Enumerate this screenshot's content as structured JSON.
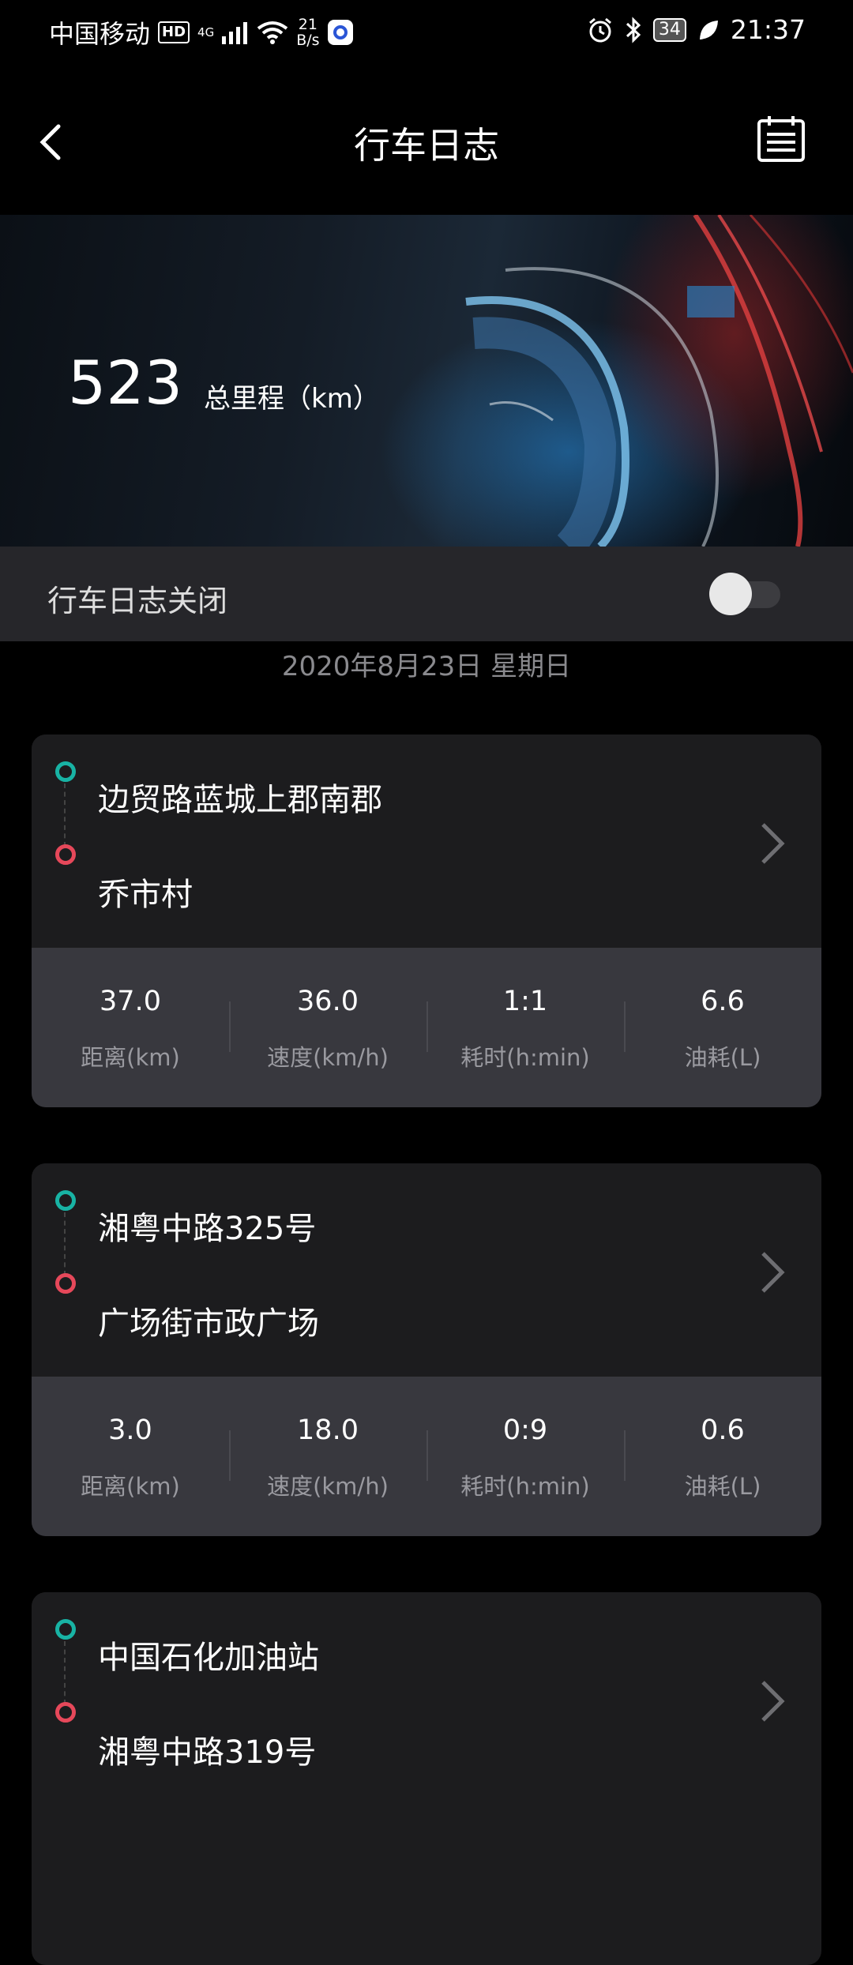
{
  "status_bar": {
    "carrier": "中国移动",
    "hd": "HD",
    "network": "4G",
    "speed_value": "21",
    "speed_unit": "B/s",
    "battery": "34",
    "time": "21:37"
  },
  "nav": {
    "title": "行车日志",
    "back_icon": "back-chevron-icon",
    "calendar_icon": "calendar-icon"
  },
  "banner": {
    "total_mileage": "523",
    "total_mileage_label": "总里程（km）"
  },
  "toggle": {
    "label": "行车日志关闭",
    "state": "off"
  },
  "date_header": "2020年8月23日 星期日",
  "trips": [
    {
      "start": "边贸路蓝城上郡南郡",
      "end": "乔市村",
      "stats": [
        {
          "value": "37.0",
          "label": "距离(km)"
        },
        {
          "value": "36.0",
          "label": "速度(km/h)"
        },
        {
          "value": "1:1",
          "label": "耗时(h:min)"
        },
        {
          "value": "6.6",
          "label": "油耗(L)"
        }
      ]
    },
    {
      "start": "湘粤中路325号",
      "end": "广场街市政广场",
      "stats": [
        {
          "value": "3.0",
          "label": "距离(km)"
        },
        {
          "value": "18.0",
          "label": "速度(km/h)"
        },
        {
          "value": "0:9",
          "label": "耗时(h:min)"
        },
        {
          "value": "0.6",
          "label": "油耗(L)"
        }
      ]
    },
    {
      "start": "中国石化加油站",
      "end": "湘粤中路319号",
      "stats": []
    }
  ],
  "colors": {
    "start_dot": "#18b3a4",
    "end_dot": "#e6485a",
    "card_bg": "#1c1c1e",
    "stats_bg": "#38383e"
  }
}
